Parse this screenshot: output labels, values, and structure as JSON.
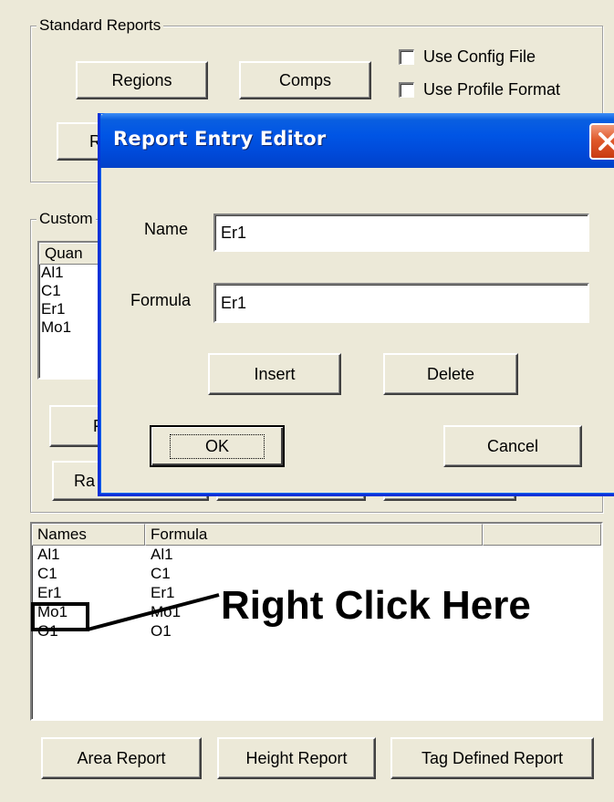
{
  "standard_reports": {
    "title": "Standard Reports",
    "regions_label": "Regions",
    "comps_label": "Comps",
    "partial_button_label": "R",
    "use_config_file_label": "Use Config File",
    "use_profile_format_label": "Use Profile Format"
  },
  "custom_reports": {
    "title_partial": "Custom",
    "list_header_partial": "Quan",
    "items": [
      "Al1",
      "C1",
      "Er1",
      "Mo1"
    ],
    "partial_button_1": "F",
    "partial_button_2": "Ra"
  },
  "names_table": {
    "columns": [
      "Names",
      "Formula"
    ],
    "rows": [
      {
        "name": "Al1",
        "formula": "Al1"
      },
      {
        "name": "C1",
        "formula": "C1"
      },
      {
        "name": "Er1",
        "formula": "Er1"
      },
      {
        "name": "Mo1",
        "formula": "Mo1"
      },
      {
        "name": "O1",
        "formula": "O1"
      }
    ]
  },
  "bottom_buttons": {
    "area_report": "Area Report",
    "height_report": "Height Report",
    "tag_defined_report": "Tag Defined Report"
  },
  "dialog": {
    "title": "Report Entry Editor",
    "name_label": "Name",
    "name_value": "Er1",
    "formula_label": "Formula",
    "formula_value": "Er1",
    "insert_label": "Insert",
    "delete_label": "Delete",
    "ok_label": "OK",
    "cancel_label": "Cancel"
  },
  "annotation": {
    "text": "Right Click Here"
  }
}
